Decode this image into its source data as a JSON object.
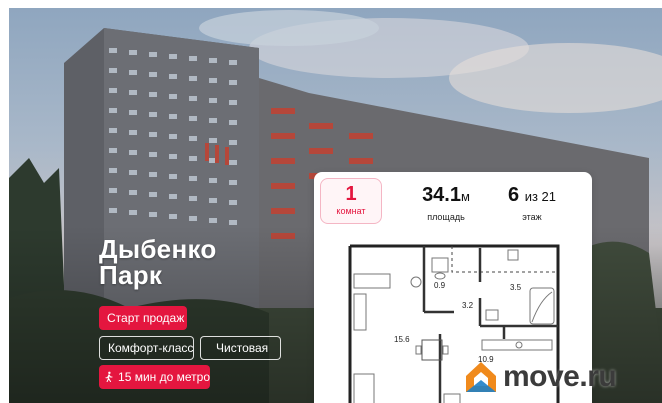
{
  "project": {
    "name_line1": "Дыбенко",
    "name_line2": "Парк"
  },
  "badges": {
    "sales_start": "Старт продаж",
    "comfort_class": "Комфорт-класс",
    "finishing": "Чистовая",
    "metro": "15 мин до метро"
  },
  "flat": {
    "rooms": "1",
    "rooms_label": "комнат",
    "area": "34.1",
    "area_unit": "м",
    "area_label": "площадь",
    "floor": "6",
    "floor_of": "из 21",
    "floor_label": "этаж"
  },
  "plan_labels": {
    "wc": "0.9",
    "bath": "3.5",
    "hall": "3.2",
    "room": "15.6",
    "kitchen": "10.9"
  },
  "logo": {
    "text": "move.ru"
  },
  "colors": {
    "accent": "#e4163f",
    "logo_orange": "#f08a1c"
  }
}
